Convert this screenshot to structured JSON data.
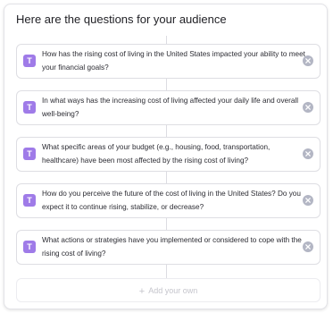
{
  "header": {
    "title": "Here are the questions for your audience"
  },
  "questions": [
    {
      "badge": "T",
      "text": "How has the rising cost of living in the United States impacted your ability to meet your financial goals?"
    },
    {
      "badge": "T",
      "text": "In what ways has the increasing cost of living affected your daily life and overall well-being?"
    },
    {
      "badge": "T",
      "text": "What specific areas of your budget (e.g., housing, food, transportation, healthcare) have been most affected by the rising cost of living?"
    },
    {
      "badge": "T",
      "text": "How do you perceive the future of the cost of living in the United States? Do you expect it to continue rising, stabilize, or decrease?"
    },
    {
      "badge": "T",
      "text": "What actions or strategies have you implemented or considered to cope with the rising cost of living?"
    }
  ],
  "add_question": {
    "label": "Add your own",
    "icon": "plus-icon"
  },
  "icons": {
    "question_type": "text-type-icon",
    "remove": "close-circle-icon"
  },
  "colors": {
    "badge": "#9f7be8",
    "remove": "#b3b6c4",
    "border": "#dedee3"
  }
}
